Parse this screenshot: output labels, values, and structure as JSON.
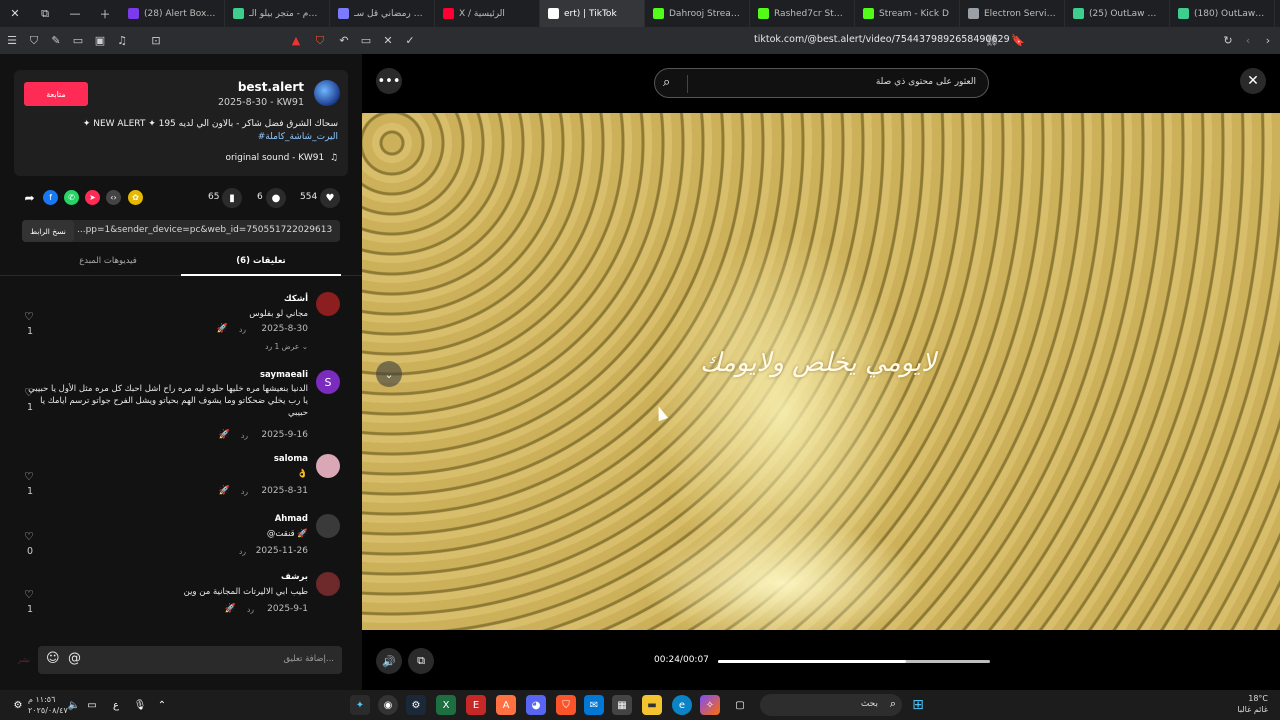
{
  "browser": {
    "tabs": [
      {
        "title": "(28) Alert Box / Stre",
        "color": "#7c3aed"
      },
      {
        "title": "برم برم - متجر بيلو الـ",
        "color": "#3ecf8e"
      },
      {
        "title": "البرت رمضاني قل سـ",
        "color": "#7b7bff"
      },
      {
        "title": "X / الرئيسية",
        "color": "#ff0033"
      },
      {
        "title": "ert) | TikTok",
        "color": "#ffffff"
      },
      {
        "title": "Dahrooj Stream - W",
        "color": "#53fc18"
      },
      {
        "title": "Rashed7cr Stream",
        "color": "#53fc18"
      },
      {
        "title": "Stream - Kick D",
        "color": "#53fc18"
      },
      {
        "title": "Electron Services",
        "color": "#9aa0a6"
      },
      {
        "title": "(25) OutLaw RD - Li",
        "color": "#3ecf8e"
      },
      {
        "title": "(180) OutLawRp 2.0",
        "color": "#3ecf8e"
      }
    ],
    "url": "tiktok.com/@best.alert/video/7544379892658490629"
  },
  "post": {
    "follow_label": "متابعة",
    "username": "best.alert",
    "date_line": "2025-8-30 - KW91",
    "description": "✦ NEW ALERT ✦ سحاك الشرق فضل شاكر - بالاون الي لديه 195",
    "hashtag": "#اليرت_شاشة_كاملة",
    "sound": "original sound - KW91",
    "sound_icon": "music-note-icon",
    "likes": "554",
    "comments": "6",
    "saves": "65",
    "copy_link_label": "نسخ الرابط",
    "link_text": "...pp=1&sender_device=pc&web_id=7505517220296132151",
    "tab_comments": "(6) تعليقات",
    "tab_creator_videos": "فيديوهات المبدع"
  },
  "comments": [
    {
      "name": "أشكك",
      "text": "مجاني لو بفلوس",
      "date": "2025-8-30",
      "reply": "رد",
      "likes": "1",
      "more": "عرض 1 رد",
      "avatar_color": "#8b1e1e"
    },
    {
      "name": "saymaeali",
      "text": "الدنيا بنعيشها مره خليها حلوه ليه مره راح اشل احبك كل مره مثل الأول يا حبيبي يا رب يخلي ضحكاتو وما يشوف الهم بحياتو ويشل الفرح جواتو ترسم ايامك يا حبيبي",
      "date": "2025-9-16",
      "reply": "رد",
      "likes": "1",
      "avatar_color": "#7b2cbf",
      "initial": "S"
    },
    {
      "name": "saloma",
      "text": "👌",
      "date": "2025-8-31",
      "reply": "رد",
      "likes": "1",
      "avatar_color": "#d9a7b5"
    },
    {
      "name": "Ahmad",
      "text": "@قنقت 🚀",
      "date": "2025-11-26",
      "reply": "رد",
      "likes": "0",
      "avatar_color": "#3a3a3a"
    },
    {
      "name": "برشف",
      "text": "طيب ابي الاليرتات المجانية من وين",
      "date": "2025-9-1",
      "reply": "رد",
      "likes": "1",
      "avatar_color": "#6e2a2a"
    }
  ],
  "comment_input": {
    "placeholder": "إضافة تعليق...",
    "post_label": "نشر"
  },
  "video": {
    "search_placeholder": "العثور على محتوى ذي صلة",
    "lyric": "لايومي يخلص ولايومك",
    "time": "00:24/00:07",
    "progress": 0.69
  },
  "taskbar": {
    "search_placeholder": "بحث",
    "temperature": "18°C",
    "weather_text": "غائم غالبا",
    "time": "١١:٥٦ م",
    "date": "٢٠٢٥/٠٨/٤٧",
    "lang": "ع"
  }
}
